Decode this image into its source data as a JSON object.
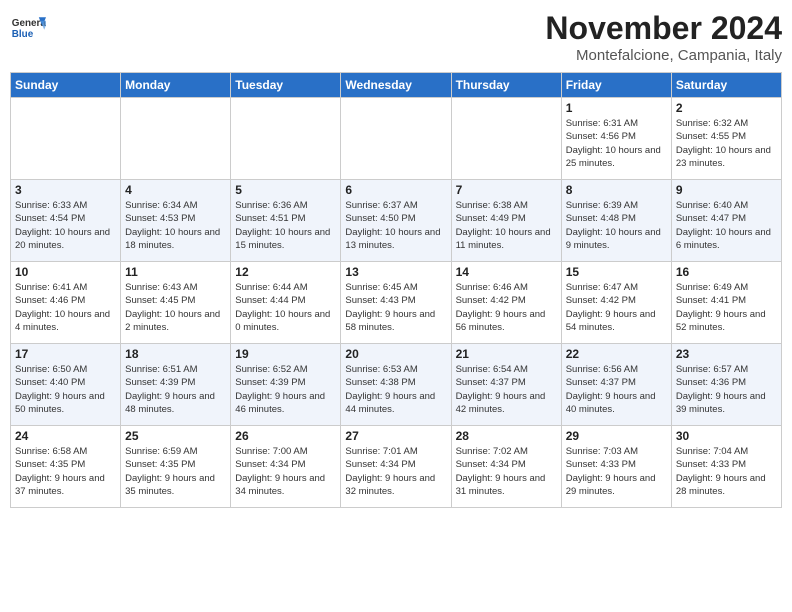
{
  "header": {
    "logo_general": "General",
    "logo_blue": "Blue",
    "month_title": "November 2024",
    "location": "Montefalcione, Campania, Italy"
  },
  "days_of_week": [
    "Sunday",
    "Monday",
    "Tuesday",
    "Wednesday",
    "Thursday",
    "Friday",
    "Saturday"
  ],
  "weeks": [
    [
      {
        "day": null
      },
      {
        "day": null
      },
      {
        "day": null
      },
      {
        "day": null
      },
      {
        "day": null
      },
      {
        "day": "1",
        "sunrise": "Sunrise: 6:31 AM",
        "sunset": "Sunset: 4:56 PM",
        "daylight": "Daylight: 10 hours and 25 minutes."
      },
      {
        "day": "2",
        "sunrise": "Sunrise: 6:32 AM",
        "sunset": "Sunset: 4:55 PM",
        "daylight": "Daylight: 10 hours and 23 minutes."
      }
    ],
    [
      {
        "day": "3",
        "sunrise": "Sunrise: 6:33 AM",
        "sunset": "Sunset: 4:54 PM",
        "daylight": "Daylight: 10 hours and 20 minutes."
      },
      {
        "day": "4",
        "sunrise": "Sunrise: 6:34 AM",
        "sunset": "Sunset: 4:53 PM",
        "daylight": "Daylight: 10 hours and 18 minutes."
      },
      {
        "day": "5",
        "sunrise": "Sunrise: 6:36 AM",
        "sunset": "Sunset: 4:51 PM",
        "daylight": "Daylight: 10 hours and 15 minutes."
      },
      {
        "day": "6",
        "sunrise": "Sunrise: 6:37 AM",
        "sunset": "Sunset: 4:50 PM",
        "daylight": "Daylight: 10 hours and 13 minutes."
      },
      {
        "day": "7",
        "sunrise": "Sunrise: 6:38 AM",
        "sunset": "Sunset: 4:49 PM",
        "daylight": "Daylight: 10 hours and 11 minutes."
      },
      {
        "day": "8",
        "sunrise": "Sunrise: 6:39 AM",
        "sunset": "Sunset: 4:48 PM",
        "daylight": "Daylight: 10 hours and 9 minutes."
      },
      {
        "day": "9",
        "sunrise": "Sunrise: 6:40 AM",
        "sunset": "Sunset: 4:47 PM",
        "daylight": "Daylight: 10 hours and 6 minutes."
      }
    ],
    [
      {
        "day": "10",
        "sunrise": "Sunrise: 6:41 AM",
        "sunset": "Sunset: 4:46 PM",
        "daylight": "Daylight: 10 hours and 4 minutes."
      },
      {
        "day": "11",
        "sunrise": "Sunrise: 6:43 AM",
        "sunset": "Sunset: 4:45 PM",
        "daylight": "Daylight: 10 hours and 2 minutes."
      },
      {
        "day": "12",
        "sunrise": "Sunrise: 6:44 AM",
        "sunset": "Sunset: 4:44 PM",
        "daylight": "Daylight: 10 hours and 0 minutes."
      },
      {
        "day": "13",
        "sunrise": "Sunrise: 6:45 AM",
        "sunset": "Sunset: 4:43 PM",
        "daylight": "Daylight: 9 hours and 58 minutes."
      },
      {
        "day": "14",
        "sunrise": "Sunrise: 6:46 AM",
        "sunset": "Sunset: 4:42 PM",
        "daylight": "Daylight: 9 hours and 56 minutes."
      },
      {
        "day": "15",
        "sunrise": "Sunrise: 6:47 AM",
        "sunset": "Sunset: 4:42 PM",
        "daylight": "Daylight: 9 hours and 54 minutes."
      },
      {
        "day": "16",
        "sunrise": "Sunrise: 6:49 AM",
        "sunset": "Sunset: 4:41 PM",
        "daylight": "Daylight: 9 hours and 52 minutes."
      }
    ],
    [
      {
        "day": "17",
        "sunrise": "Sunrise: 6:50 AM",
        "sunset": "Sunset: 4:40 PM",
        "daylight": "Daylight: 9 hours and 50 minutes."
      },
      {
        "day": "18",
        "sunrise": "Sunrise: 6:51 AM",
        "sunset": "Sunset: 4:39 PM",
        "daylight": "Daylight: 9 hours and 48 minutes."
      },
      {
        "day": "19",
        "sunrise": "Sunrise: 6:52 AM",
        "sunset": "Sunset: 4:39 PM",
        "daylight": "Daylight: 9 hours and 46 minutes."
      },
      {
        "day": "20",
        "sunrise": "Sunrise: 6:53 AM",
        "sunset": "Sunset: 4:38 PM",
        "daylight": "Daylight: 9 hours and 44 minutes."
      },
      {
        "day": "21",
        "sunrise": "Sunrise: 6:54 AM",
        "sunset": "Sunset: 4:37 PM",
        "daylight": "Daylight: 9 hours and 42 minutes."
      },
      {
        "day": "22",
        "sunrise": "Sunrise: 6:56 AM",
        "sunset": "Sunset: 4:37 PM",
        "daylight": "Daylight: 9 hours and 40 minutes."
      },
      {
        "day": "23",
        "sunrise": "Sunrise: 6:57 AM",
        "sunset": "Sunset: 4:36 PM",
        "daylight": "Daylight: 9 hours and 39 minutes."
      }
    ],
    [
      {
        "day": "24",
        "sunrise": "Sunrise: 6:58 AM",
        "sunset": "Sunset: 4:35 PM",
        "daylight": "Daylight: 9 hours and 37 minutes."
      },
      {
        "day": "25",
        "sunrise": "Sunrise: 6:59 AM",
        "sunset": "Sunset: 4:35 PM",
        "daylight": "Daylight: 9 hours and 35 minutes."
      },
      {
        "day": "26",
        "sunrise": "Sunrise: 7:00 AM",
        "sunset": "Sunset: 4:34 PM",
        "daylight": "Daylight: 9 hours and 34 minutes."
      },
      {
        "day": "27",
        "sunrise": "Sunrise: 7:01 AM",
        "sunset": "Sunset: 4:34 PM",
        "daylight": "Daylight: 9 hours and 32 minutes."
      },
      {
        "day": "28",
        "sunrise": "Sunrise: 7:02 AM",
        "sunset": "Sunset: 4:34 PM",
        "daylight": "Daylight: 9 hours and 31 minutes."
      },
      {
        "day": "29",
        "sunrise": "Sunrise: 7:03 AM",
        "sunset": "Sunset: 4:33 PM",
        "daylight": "Daylight: 9 hours and 29 minutes."
      },
      {
        "day": "30",
        "sunrise": "Sunrise: 7:04 AM",
        "sunset": "Sunset: 4:33 PM",
        "daylight": "Daylight: 9 hours and 28 minutes."
      }
    ]
  ]
}
